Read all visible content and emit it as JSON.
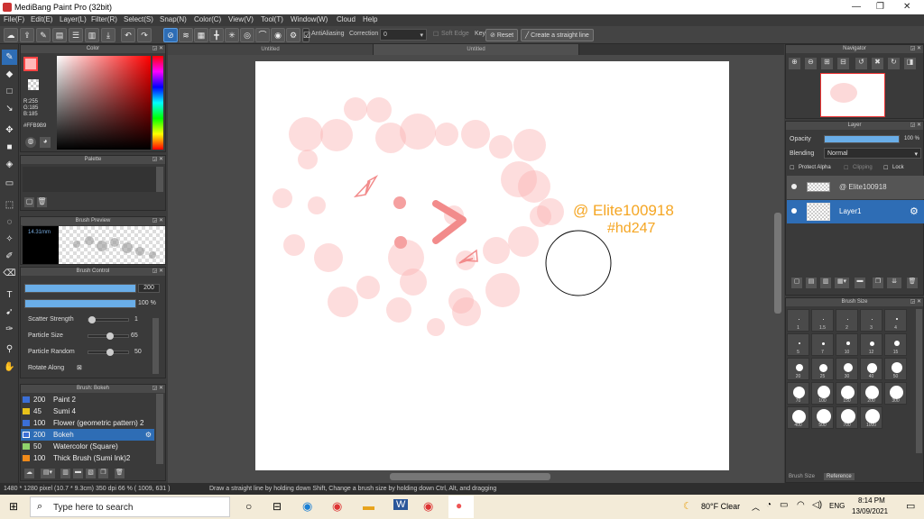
{
  "window": {
    "title": "MediBang Paint Pro (32bit)",
    "min": "—",
    "max": "❐",
    "close": "✕"
  },
  "menu": [
    "File(F)",
    "Edit(E)",
    "Layer(L)",
    "Filter(R)",
    "Select(S)",
    "Snap(N)",
    "Color(C)",
    "View(V)",
    "Tool(T)",
    "Window(W)",
    "Cloud",
    "Help"
  ],
  "toolbar": {
    "antialiasing": "AntiAliasing",
    "correction_label": "Correction",
    "correction_value": "0",
    "soft_edge": "Soft Edge",
    "key_label": "Key",
    "reset": "Reset",
    "straight_line": "Create a straight line"
  },
  "color_panel": {
    "title": "Color",
    "r": "R:255",
    "g": "G:185",
    "b": "B:185",
    "hex": "#FFB9B9"
  },
  "palette_panel": {
    "title": "Palette"
  },
  "brush_preview": {
    "title": "Brush Preview",
    "size": "14.31mm"
  },
  "brush_control": {
    "title": "Brush Control",
    "size_value": "200",
    "opacity_value": "100 %",
    "params": [
      {
        "label": "Scatter Strength",
        "value": "1"
      },
      {
        "label": "Particle Size",
        "value": "65"
      },
      {
        "label": "Particle Random",
        "value": "50"
      },
      {
        "label": "Rotate Along",
        "value": ""
      }
    ]
  },
  "brush_list": {
    "title": "Brush: Bokeh",
    "items": [
      {
        "size": "200",
        "name": "Paint 2",
        "color": "#3b6fd6"
      },
      {
        "size": "45",
        "name": "Sumi 4",
        "color": "#e8c21a"
      },
      {
        "size": "100",
        "name": "Flower (geometric pattern) 2",
        "color": "#3b6fd6"
      },
      {
        "size": "200",
        "name": "Bokeh",
        "color": "#3b6fd6"
      },
      {
        "size": "50",
        "name": "Watercolor (Square)",
        "color": "#8fd16a"
      },
      {
        "size": "100",
        "name": "Thick Brush (Sumi Ink)2",
        "color": "#f08a1a"
      }
    ],
    "selected_index": 3
  },
  "tabs": [
    "Untitled",
    "Untitled"
  ],
  "canvas": {
    "watermark_line1": "@ Elite100918",
    "watermark_line2": "#hd247",
    "watermark_color": "#f5a623"
  },
  "navigator": {
    "title": "Navigator"
  },
  "layer_panel": {
    "title": "Layer",
    "opacity_label": "Opacity",
    "opacity_value": "100 %",
    "opacity_fraction": 1.0,
    "blending_label": "Blending",
    "blending_value": "Normal",
    "protect_alpha": "Protect Alpha",
    "clipping": "Clipping",
    "lock": "Lock",
    "layers": [
      {
        "name": "@ Elite100918",
        "selected": false
      },
      {
        "name": "Layer1",
        "selected": true
      }
    ]
  },
  "brush_size_panel": {
    "title": "Brush Size",
    "sizes": [
      "1",
      "1.5",
      "2",
      "3",
      "4",
      "5",
      "7",
      "10",
      "12",
      "15",
      "20",
      "25",
      "30",
      "40",
      "50",
      "70",
      "100",
      "150",
      "200",
      "300",
      "400",
      "500",
      "700",
      "1000"
    ],
    "tabs": [
      "Brush Size",
      "Reference"
    ]
  },
  "status": {
    "dims": "1480 * 1280 pixel  (10.7 * 9.3cm)  350 dpi  66 %  ( 1009, 631 )",
    "hint": "Draw a straight line by holding down Shift, Change a brush size by holding down Ctrl, Alt, and dragging"
  },
  "taskbar": {
    "search_placeholder": "Type here to search",
    "weather": "80°F  Clear",
    "lang": "ENG",
    "time": "8:14 PM",
    "date": "13/09/2021"
  },
  "colors": {
    "accent": "#2e6db5",
    "bokeh": "#ffb9b9",
    "arrow": "#f28b8b"
  }
}
